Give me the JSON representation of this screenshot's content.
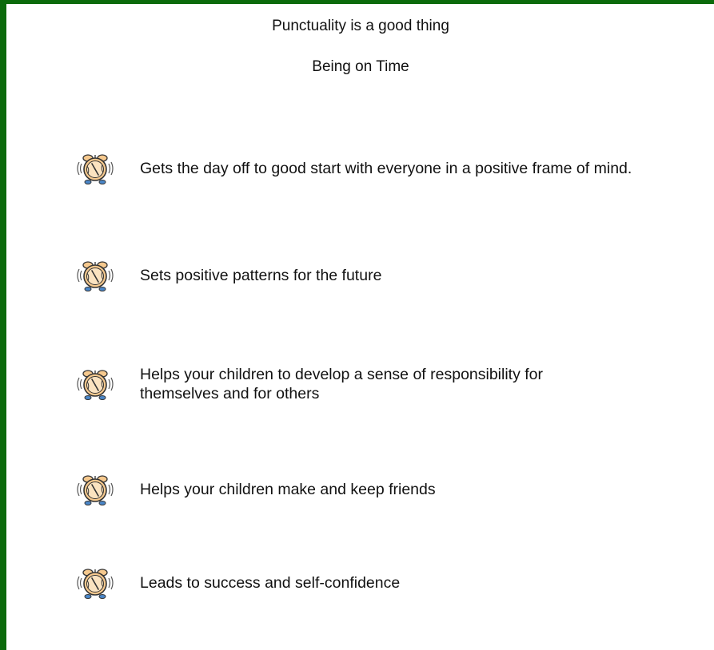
{
  "header": {
    "title": "Punctuality is a good thing",
    "subtitle": "Being on Time"
  },
  "items": [
    {
      "icon": "alarm-clock-icon",
      "text": "Gets the day off to good start with everyone in a positive frame of mind."
    },
    {
      "icon": "alarm-clock-icon",
      "text": "Sets positive patterns for the future"
    },
    {
      "icon": "alarm-clock-icon",
      "text": "Helps your children to develop a sense of responsibility for themselves and for others"
    },
    {
      "icon": "alarm-clock-icon",
      "text": "Helps your children make and keep friends"
    },
    {
      "icon": "alarm-clock-icon",
      "text": "Leads to success and self-confidence"
    }
  ],
  "colors": {
    "frame": "#0b6a0b",
    "background": "#ffffff",
    "clock_face": "#f6c98e",
    "clock_feet": "#4a86c8"
  }
}
